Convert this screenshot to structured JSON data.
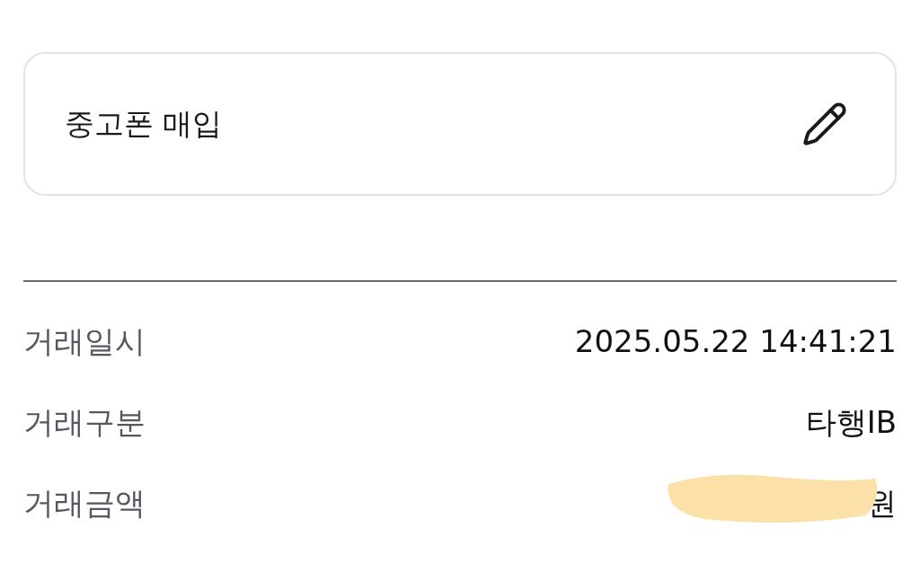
{
  "memo": {
    "text": "중고폰 매입"
  },
  "details": [
    {
      "label": "거래일시",
      "value": "2025.05.22 14:41:21",
      "redacted": false
    },
    {
      "label": "거래구분",
      "value": "타행IB",
      "redacted": false
    },
    {
      "label": "거래금액",
      "value": "원",
      "redacted": true
    }
  ]
}
